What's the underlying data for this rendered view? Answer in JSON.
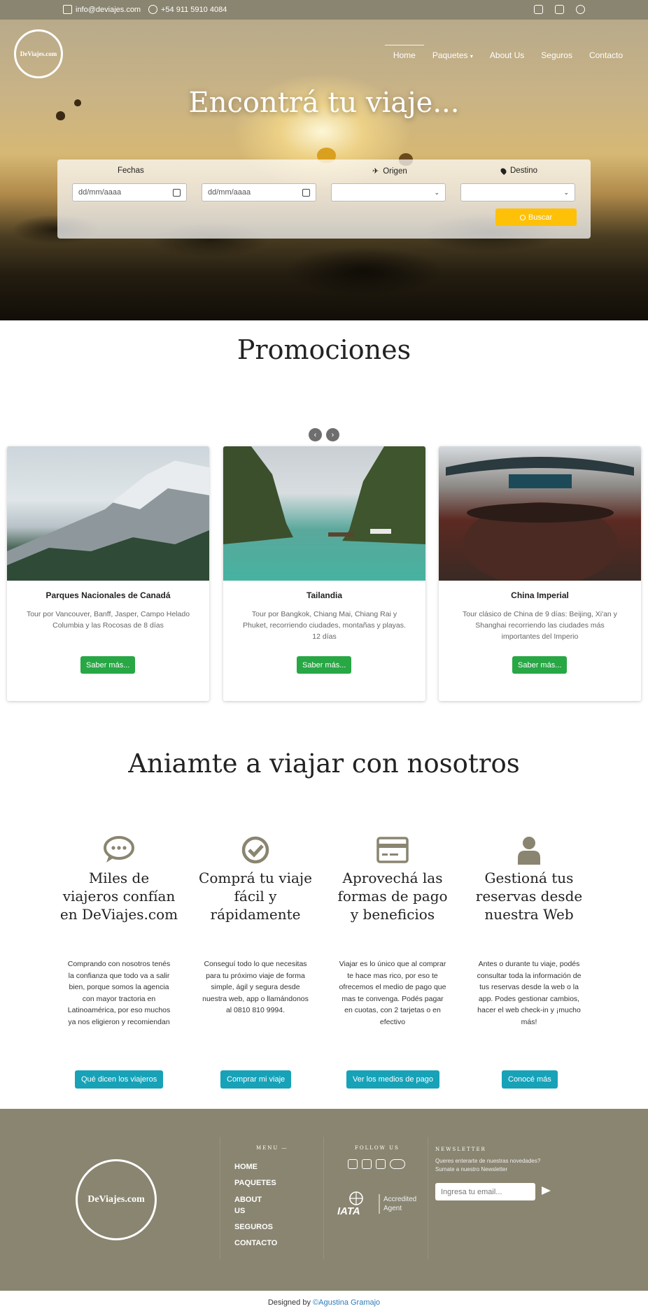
{
  "topbar": {
    "email": "info@deviajes.com",
    "phone": "+54 911 5910 4084",
    "social": [
      "instagram-icon",
      "facebook-icon",
      "pinterest-icon"
    ]
  },
  "brand": {
    "logo_text": "DeViajes.com"
  },
  "nav": {
    "items": [
      {
        "label": "Home",
        "active": true
      },
      {
        "label": "Paquetes",
        "dropdown": true
      },
      {
        "label": "About Us"
      },
      {
        "label": "Seguros"
      },
      {
        "label": "Contacto"
      }
    ]
  },
  "hero": {
    "title": "Encontrá tu viaje...",
    "search": {
      "fechas_label": "Fechas",
      "origen_label": "Origen",
      "destino_label": "Destino",
      "date_from_placeholder": "dd/mm/aaaa",
      "date_to_placeholder": "dd/mm/aaaa",
      "origen_value": "",
      "destino_value": "",
      "button_label": "Buscar"
    }
  },
  "promociones": {
    "title": "Promociones",
    "cards": [
      {
        "title": "Parques Nacionales de Canadá",
        "text": "Tour por Vancouver, Banff, Jasper, Campo Helado Columbia y las Rocosas de 8 días",
        "button": "Saber más..."
      },
      {
        "title": "Tailandia",
        "text": "Tour por Bangkok, Chiang Mai, Chiang Rai y Phuket, recorriendo ciudades, montañas y playas. 12 días",
        "button": "Saber más..."
      },
      {
        "title": "China Imperial",
        "text": "Tour clásico de China de 9 días: Beijing, Xi'an y Shanghai recorriendo las ciudades más importantes del Imperio",
        "button": "Saber más..."
      }
    ]
  },
  "features": {
    "title": "Aniamte a viajar con nosotros",
    "items": [
      {
        "icon": "chat-bubble-icon",
        "title": "Miles de viajeros confían en DeViajes.com",
        "text": "Comprando con nosotros tenés la confianza que todo va a salir bien, porque somos la agencia con mayor tractoria en Latinoamérica, por eso muchos ya nos eligieron y recomiendan",
        "button": "Qué dicen los viajeros"
      },
      {
        "icon": "check-circle-icon",
        "title": "Comprá tu viaje fácil y rápidamente",
        "text": "Conseguí todo lo que necesitas para tu próximo viaje de forma simple, ágil y segura desde nuestra web, app o llamándonos al 0810 810 9994.",
        "button": "Comprar mi viaje"
      },
      {
        "icon": "credit-card-icon",
        "title": "Aprovechá las formas de pago y beneficios",
        "text": "Viajar es lo único que al comprar te hace mas rico, por eso te ofrecemos el medio de pago que mas te convenga. Podés pagar en cuotas, con 2 tarjetas o en efectivo",
        "button": "Ver los medios de pago"
      },
      {
        "icon": "user-icon",
        "title": "Gestioná tus reservas desde nuestra Web",
        "text": "Antes o durante tu viaje, podés consultar toda la información de tus reservas desde la web o la app. Podes gestionar cambios, hacer el web check-in y ¡mucho más!",
        "button": "Conocé más"
      }
    ]
  },
  "footer": {
    "logo_text": "DeViajes.com",
    "menu_heading": "MENU —",
    "menu": [
      "HOME",
      "PAQUETES",
      "ABOUT US",
      "SEGUROS",
      "CONTACTO"
    ],
    "follow_heading": "FOLLOW US",
    "social": [
      "facebook-icon",
      "twitter-icon",
      "instagram-icon",
      "tripadvisor-icon"
    ],
    "iata": {
      "mark": "IATA",
      "line1": "Accredited",
      "line2": "Agent"
    },
    "newsletter_heading": "NEWSLETTER",
    "newsletter_text_1": "Queres enterarte de nuestras novedades?",
    "newsletter_text_2": "Sumate a nuestro Newsletter",
    "newsletter_placeholder": "Ingresa tu email..."
  },
  "credit": {
    "prefix": "Designed by ",
    "author": "©Agustina Gramajo"
  }
}
